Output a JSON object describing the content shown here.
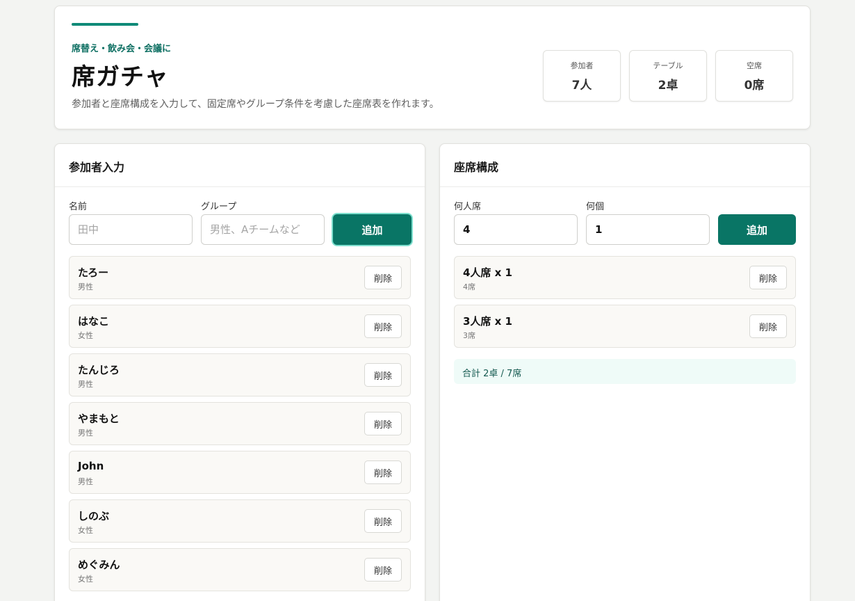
{
  "header": {
    "eyebrow": "席替え・飲み会・会議に",
    "title": "席ガチャ",
    "description": "参加者と座席構成を入力して、固定席やグループ条件を考慮した座席表を作れます。",
    "stats": [
      {
        "label": "参加者",
        "value": "7人"
      },
      {
        "label": "テーブル",
        "value": "2卓"
      },
      {
        "label": "空席",
        "value": "0席"
      }
    ]
  },
  "participants": {
    "title": "参加者入力",
    "name_label": "名前",
    "name_placeholder": "田中",
    "group_label": "グループ",
    "group_placeholder": "男性、Aチームなど",
    "add_label": "追加",
    "delete_label": "削除",
    "items": [
      {
        "name": "たろー",
        "group": "男性"
      },
      {
        "name": "はなこ",
        "group": "女性"
      },
      {
        "name": "たんじろ",
        "group": "男性"
      },
      {
        "name": "やまもと",
        "group": "男性"
      },
      {
        "name": "John",
        "group": "男性"
      },
      {
        "name": "しのぶ",
        "group": "女性"
      },
      {
        "name": "めぐみん",
        "group": "女性"
      }
    ]
  },
  "seating": {
    "title": "座席構成",
    "seats_label": "何人席",
    "seats_value": "4",
    "count_label": "何個",
    "count_value": "1",
    "add_label": "追加",
    "delete_label": "削除",
    "items": [
      {
        "name": "4人席 x 1",
        "detail": "4席"
      },
      {
        "name": "3人席 x 1",
        "detail": "3席"
      }
    ],
    "summary": "合計 2卓 / 7席"
  },
  "colors": {
    "accent": "#0f8a78",
    "primary_button": "#097565",
    "summary_bg": "#effbf8"
  }
}
